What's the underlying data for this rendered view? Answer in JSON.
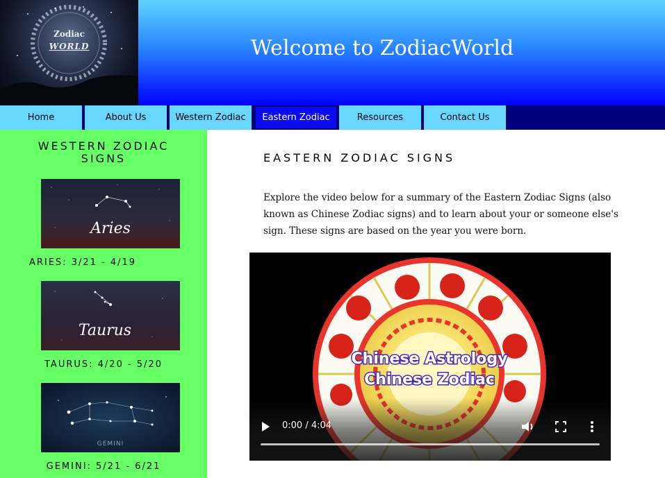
{
  "header": {
    "logo_line1": "Zodiac",
    "logo_line2": "WORLD",
    "title": "Welcome to ZodiacWorld"
  },
  "nav": {
    "items": [
      {
        "label": "Home"
      },
      {
        "label": "About Us"
      },
      {
        "label": "Western Zodiac"
      },
      {
        "label": "Eastern Zodiac",
        "active": true
      },
      {
        "label": "Resources"
      },
      {
        "label": "Contact Us"
      }
    ]
  },
  "sidebar": {
    "title": "WESTERN ZODIAC SIGNS",
    "signs": [
      {
        "image_text": "Aries",
        "caption": "ARIES: 3/21 - 4/19"
      },
      {
        "image_text": "Taurus",
        "caption": "TAURUS: 4/20 - 5/20"
      },
      {
        "image_text": "GEMINI",
        "caption": "GEMINI: 5/21 - 6/21"
      }
    ]
  },
  "main": {
    "heading": "EASTERN ZODIAC SIGNS",
    "intro": "Explore the video below for a summary of the Eastern Zodiac Signs (also known as Chinese Zodiac signs) and to learn about your or someone else's sign. These signs are based on the year you were born."
  },
  "video": {
    "overlay_line1": "Chinese Astrology",
    "overlay_line2": "Chinese Zodiac",
    "time": "0:00 / 4:04",
    "progress": 0
  },
  "colors": {
    "nav_bg": "#69d6ff",
    "nav_active": "#0a0af0",
    "sidebar_bg": "#66ff66",
    "header_gradient_top": "#5fd3ff",
    "header_gradient_bottom": "#0000ff"
  }
}
